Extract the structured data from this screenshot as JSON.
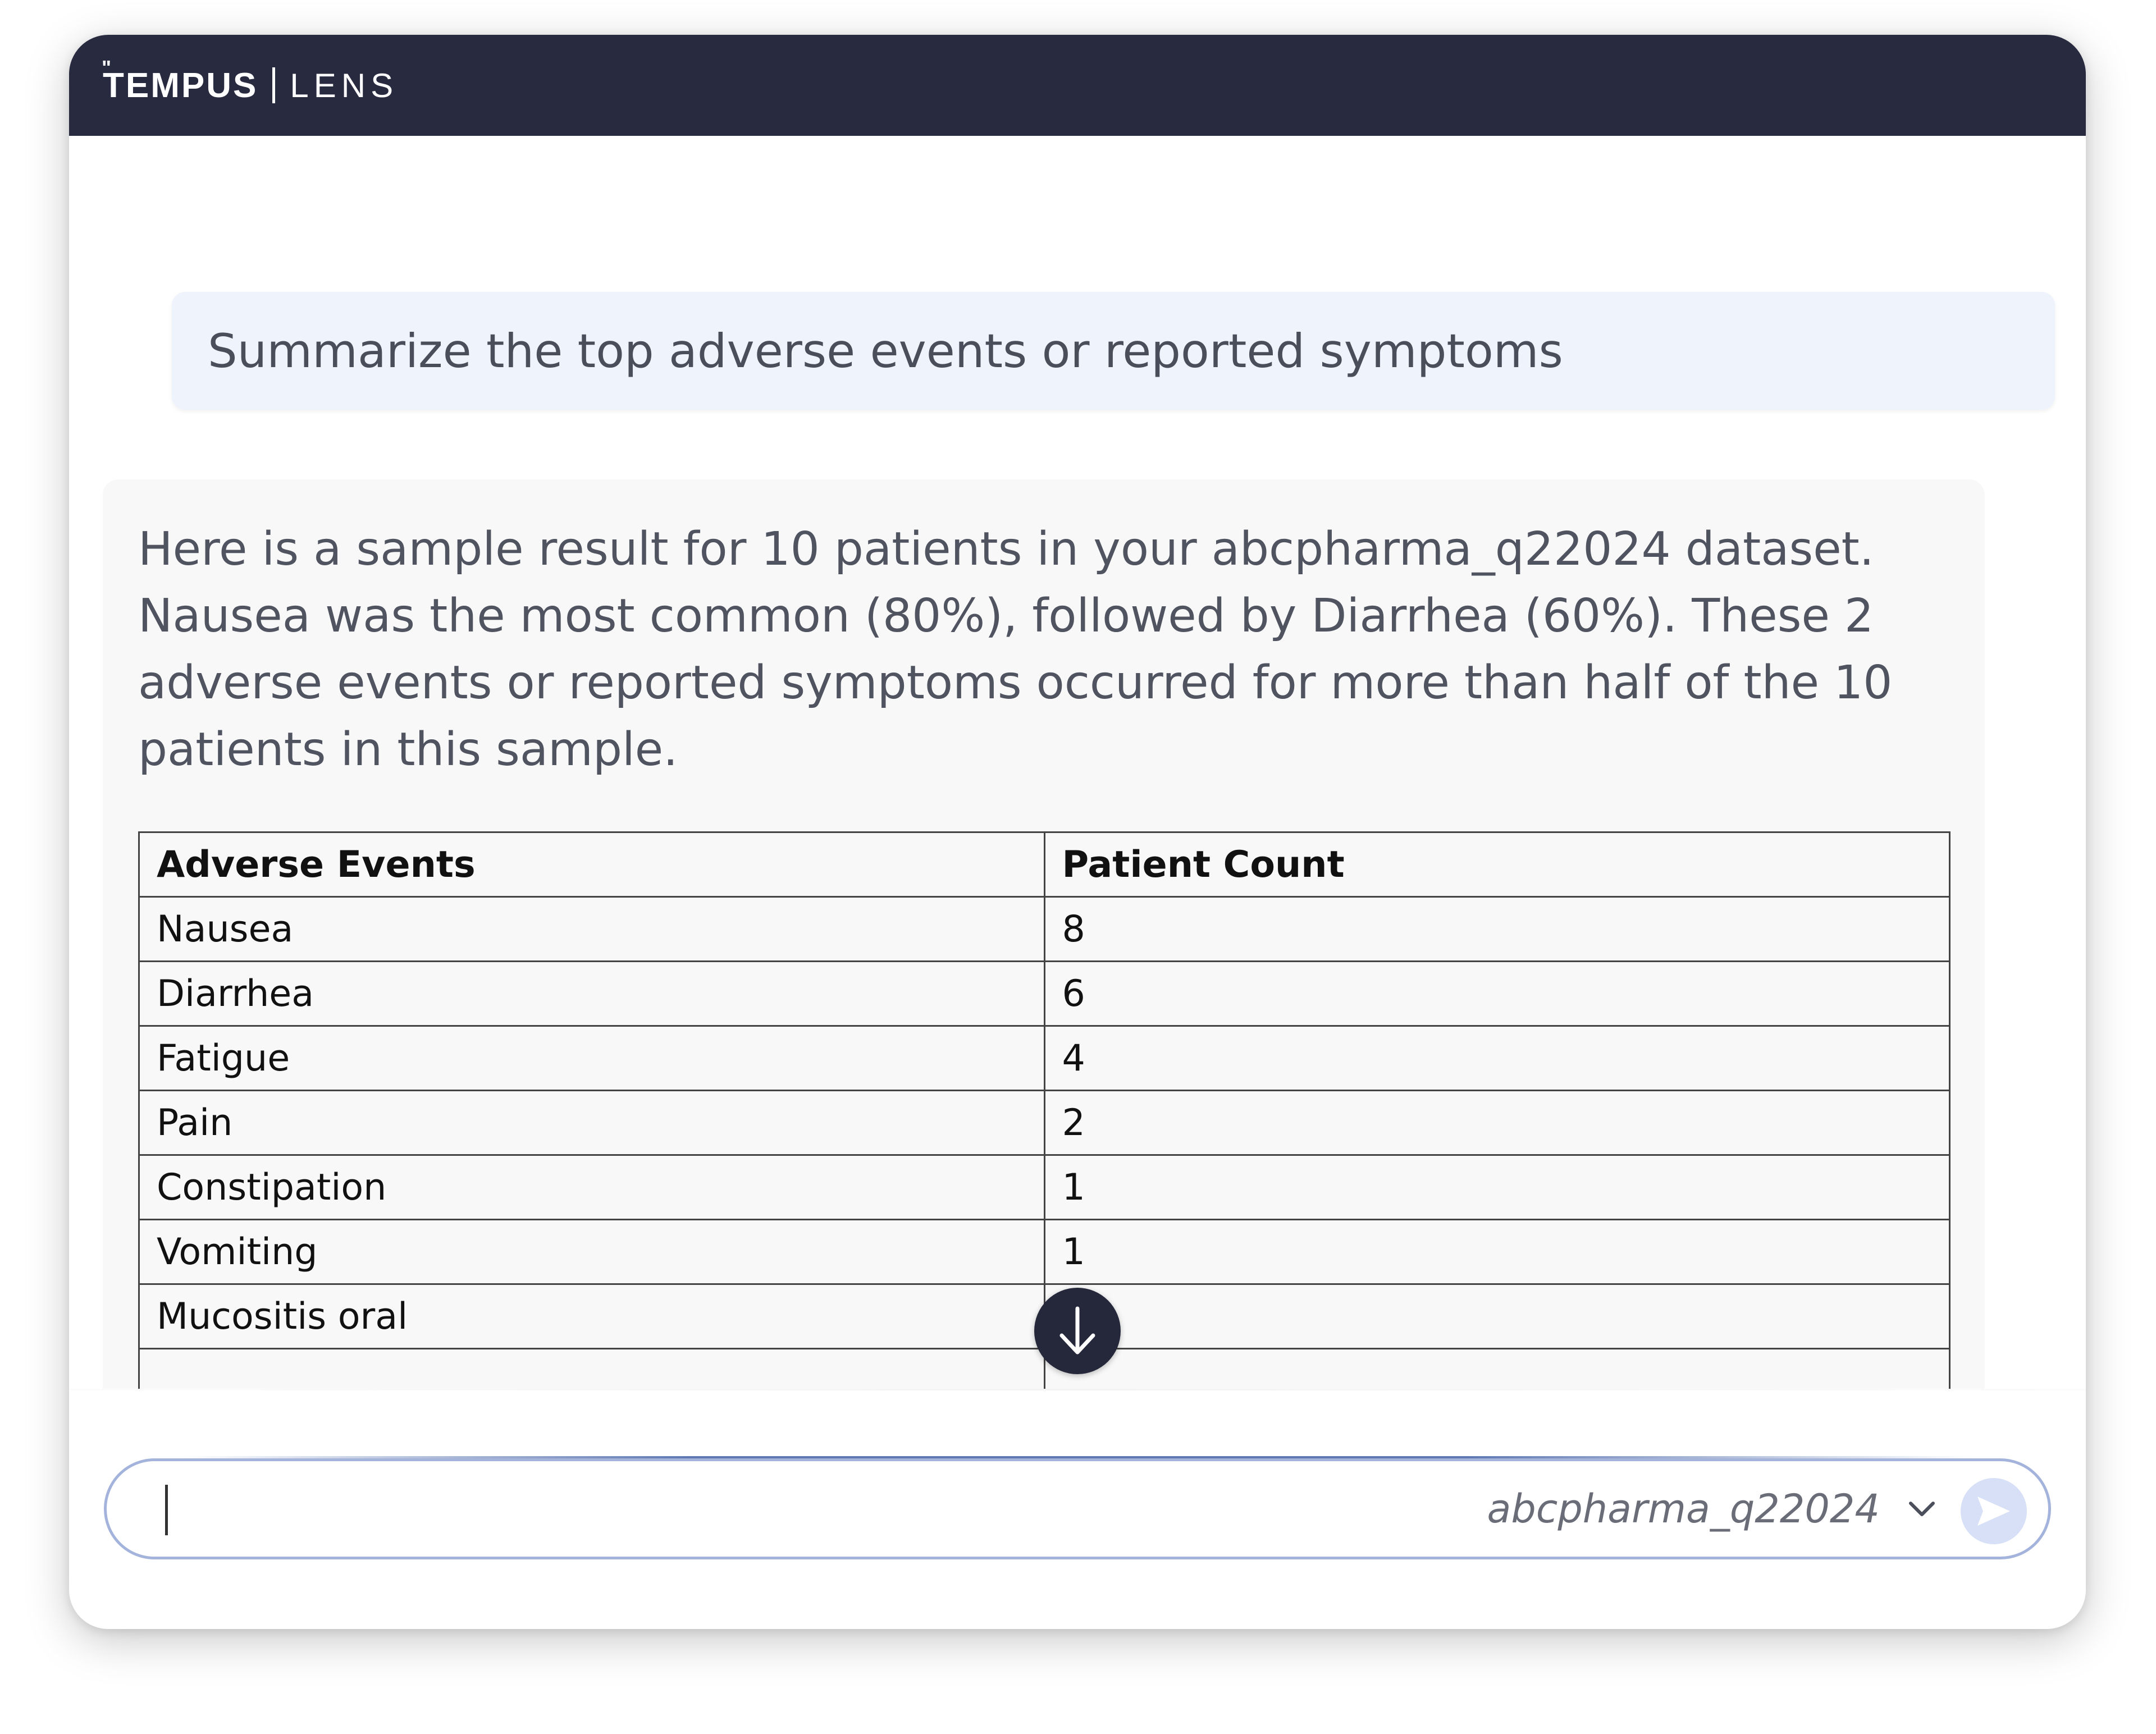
{
  "app": {
    "brand_name": "TEMPUS",
    "brand_mark": "\"",
    "product_name": "LENS"
  },
  "conversation": {
    "user_message": "Summarize the top adverse events or reported symptoms",
    "assistant_message": "Here is a sample result for 10 patients in your abcpharma_q22024 dataset. Nausea was the most common (80%), followed by Diarrhea (60%). These 2 adverse events or reported symptoms occurred for more than half of the 10 patients in this sample.",
    "table": {
      "headers": [
        "Adverse Events",
        "Patient Count"
      ],
      "rows": [
        [
          "Nausea",
          "8"
        ],
        [
          "Diarrhea",
          "6"
        ],
        [
          "Fatigue",
          "4"
        ],
        [
          "Pain",
          "2"
        ],
        [
          "Constipation",
          "1"
        ],
        [
          "Vomiting",
          "1"
        ],
        [
          "Mucositis oral",
          ""
        ],
        [
          "",
          ""
        ]
      ]
    }
  },
  "composer": {
    "input_value": "",
    "dataset_selected": "abcpharma_q22024"
  },
  "icons": {
    "scroll_down": "arrow-down-icon",
    "dataset_dropdown": "chevron-down-icon",
    "send": "send-icon"
  },
  "colors": {
    "header_bg": "#282a3f",
    "user_bubble_bg": "#eef3fc",
    "assistant_bubble_bg": "#f8f8f8",
    "composer_border": "#a3b3dc",
    "send_button_bg": "#d7e0f6"
  }
}
